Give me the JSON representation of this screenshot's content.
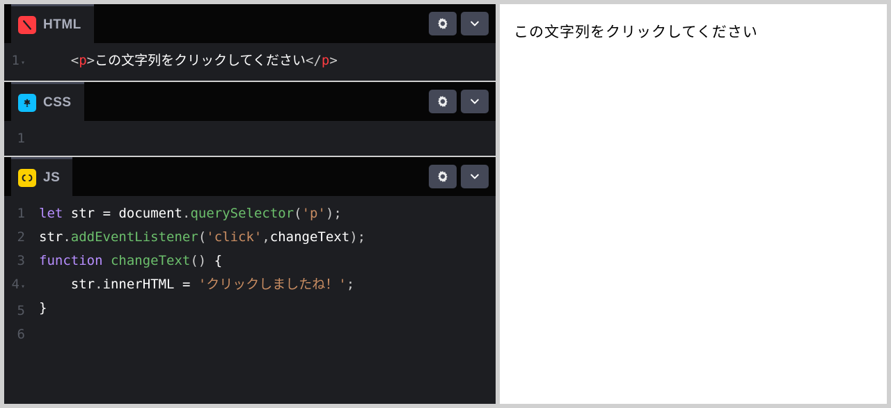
{
  "panels": {
    "html": {
      "title": "HTML",
      "lines": {
        "nums": [
          "1"
        ],
        "content": {
          "line1": {
            "indent": "    ",
            "open_a": "<",
            "open_b": "p",
            "open_c": ">",
            "text": "この文字列をクリックしてください",
            "close_a": "</",
            "close_b": "p",
            "close_c": ">"
          }
        }
      }
    },
    "css": {
      "title": "CSS",
      "lines": {
        "nums": [
          "1"
        ]
      }
    },
    "js": {
      "title": "JS",
      "lines": {
        "nums": [
          "1",
          "2",
          "3",
          "4",
          "5",
          "6"
        ],
        "content": {
          "l1": {
            "kw": "let",
            "sp": " ",
            "var": "str",
            "sp2": " ",
            "op": "=",
            "sp3": " ",
            "obj": "document",
            "dot": ".",
            "method": "querySelector",
            "open": "(",
            "arg": "'p'",
            "close": ")",
            "semi": ";"
          },
          "l2": {
            "obj": "str",
            "dot": ".",
            "method": "addEventListener",
            "open": "(",
            "arg1": "'click'",
            "comma": ",",
            "arg2": "changeText",
            "close": ")",
            "semi": ";"
          },
          "l3": {
            "blank": ""
          },
          "l4": {
            "kw": "function",
            "sp": " ",
            "name": "changeText",
            "parens": "()",
            "sp2": " ",
            "brace": "{"
          },
          "l5": {
            "indent": "    ",
            "obj": "str",
            "dot": ".",
            "prop": "innerHTML",
            "sp": " ",
            "op": "=",
            "sp2": " ",
            "str": "'クリックしましたね！'",
            "semi": ";"
          },
          "l6": {
            "brace": "}"
          }
        }
      }
    }
  },
  "preview": {
    "text": "この文字列をクリックしてください"
  }
}
